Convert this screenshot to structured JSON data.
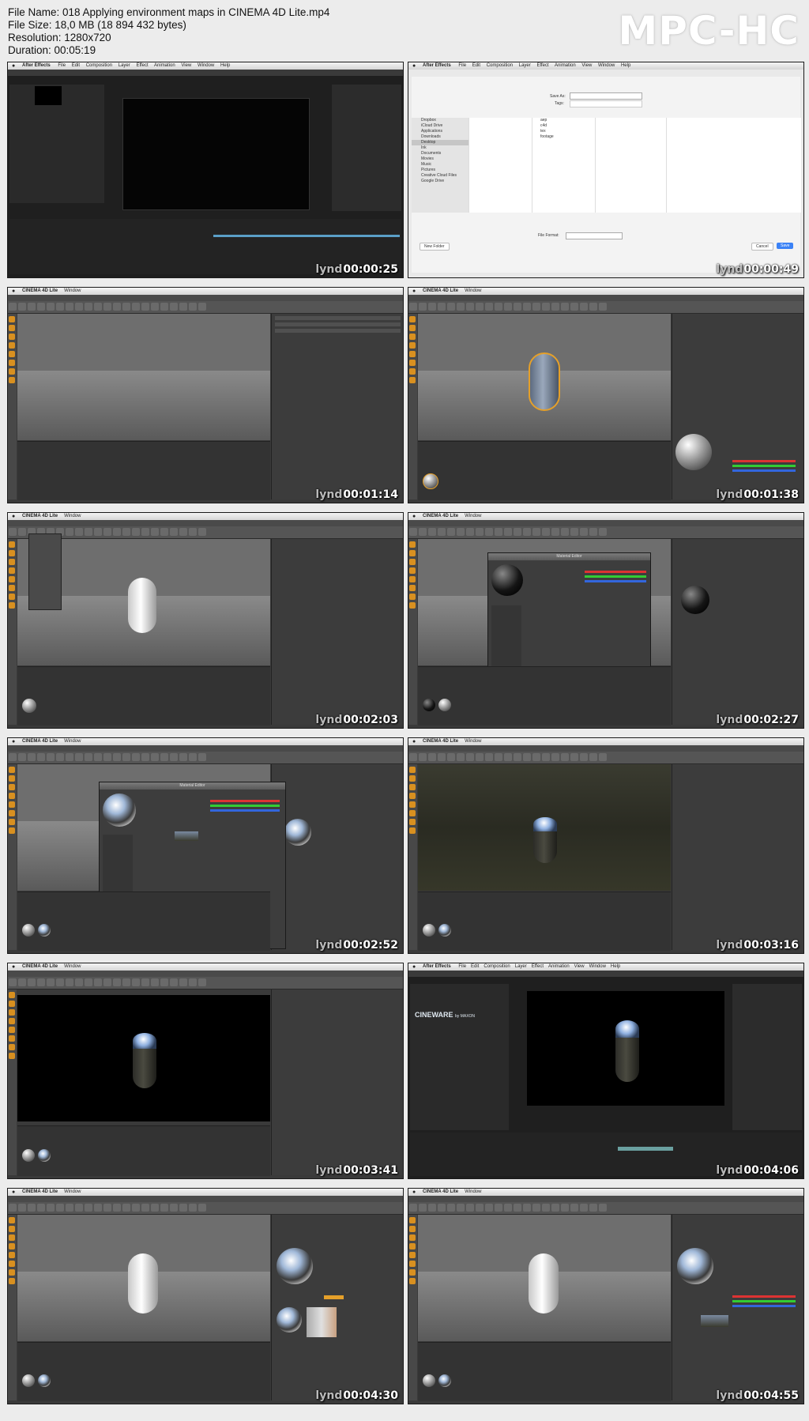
{
  "info": {
    "file_name": "File Name: 018 Applying environment maps in CINEMA 4D Lite.mp4",
    "file_size": "File Size: 18,0 MB (18 894 432 bytes)",
    "resolution": "Resolution: 1280x720",
    "duration": "Duration: 00:05:19"
  },
  "player": {
    "brand": "MPC-HC"
  },
  "watermark": "lynd",
  "apps": {
    "ae": "After Effects",
    "c4d": "CINEMA 4D Lite",
    "c4d_window": "Window",
    "cineware": "CINEWARE",
    "cineware_by": "by MAXON"
  },
  "menus": {
    "ae": [
      "File",
      "Edit",
      "Composition",
      "Layer",
      "Effect",
      "Animation",
      "View",
      "Window",
      "Help"
    ]
  },
  "material_editor_title": "Material Editor",
  "file_dialog": {
    "save_as_label": "Save As:",
    "tags_label": "Tags:",
    "file_format_label": "File Format:",
    "new_folder": "New Folder",
    "cancel": "Cancel",
    "save": "Save",
    "sidebar": [
      "Dropbox",
      "iCloud Drive",
      "Applications",
      "Downloads",
      "Desktop",
      "Ink",
      "Documents",
      "Movies",
      "Music",
      "Pictures",
      "Creative Cloud Files",
      "Google Drive"
    ],
    "selected_sidebar": "Desktop",
    "col2": [
      "aep",
      "c4d",
      "tex",
      "footage"
    ]
  },
  "frames": [
    {
      "time": "00:00:25",
      "app": "ae"
    },
    {
      "time": "00:00:49",
      "app": "file-dialog"
    },
    {
      "time": "00:01:14",
      "app": "c4d"
    },
    {
      "time": "00:01:38",
      "app": "c4d"
    },
    {
      "time": "00:02:03",
      "app": "c4d"
    },
    {
      "time": "00:02:27",
      "app": "c4d"
    },
    {
      "time": "00:02:52",
      "app": "c4d"
    },
    {
      "time": "00:03:16",
      "app": "c4d"
    },
    {
      "time": "00:03:41",
      "app": "c4d"
    },
    {
      "time": "00:04:06",
      "app": "ae"
    },
    {
      "time": "00:04:30",
      "app": "c4d"
    },
    {
      "time": "00:04:55",
      "app": "c4d"
    }
  ]
}
